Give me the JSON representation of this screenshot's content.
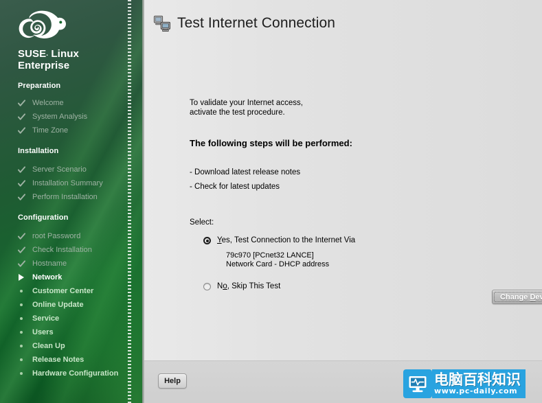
{
  "window": {
    "title": "Test Internet Connection",
    "title_icon": "network-computers-icon"
  },
  "sidebar": {
    "brand": {
      "line1_bold": "SUSE",
      "line1_reg": ".",
      "line1_rest": " Linux",
      "line2": "Enterprise",
      "logo_icon": "suse-chameleon-logo"
    },
    "sections": [
      {
        "heading": "Preparation",
        "items": [
          {
            "label": "Welcome",
            "state": "done",
            "mark": "check-icon"
          },
          {
            "label": "System Analysis",
            "state": "done",
            "mark": "check-icon"
          },
          {
            "label": "Time Zone",
            "state": "done",
            "mark": "check-icon"
          }
        ]
      },
      {
        "heading": "Installation",
        "items": [
          {
            "label": "Server Scenario",
            "state": "done",
            "mark": "check-icon"
          },
          {
            "label": "Installation Summary",
            "state": "done",
            "mark": "check-icon"
          },
          {
            "label": "Perform Installation",
            "state": "done",
            "mark": "check-icon"
          }
        ]
      },
      {
        "heading": "Configuration",
        "items": [
          {
            "label": "root Password",
            "state": "done",
            "mark": "check-icon"
          },
          {
            "label": "Check Installation",
            "state": "done",
            "mark": "check-icon"
          },
          {
            "label": "Hostname",
            "state": "done",
            "mark": "check-icon"
          },
          {
            "label": "Network",
            "state": "current",
            "mark": "triangle-right-icon"
          },
          {
            "label": "Customer Center",
            "state": "pending",
            "mark": "bullet-dot-icon"
          },
          {
            "label": "Online Update",
            "state": "pending",
            "mark": "bullet-dot-icon"
          },
          {
            "label": "Service",
            "state": "pending",
            "mark": "bullet-dot-icon"
          },
          {
            "label": "Users",
            "state": "pending",
            "mark": "bullet-dot-icon"
          },
          {
            "label": "Clean Up",
            "state": "pending",
            "mark": "bullet-dot-icon"
          },
          {
            "label": "Release Notes",
            "state": "pending",
            "mark": "bullet-dot-icon"
          },
          {
            "label": "Hardware Configuration",
            "state": "pending",
            "mark": "bullet-dot-icon"
          }
        ]
      }
    ]
  },
  "main": {
    "intro_line1": "To validate your Internet access,",
    "intro_line2": "activate the test procedure.",
    "steps_heading": "The following steps will be performed:",
    "steps": [
      "- Download latest release notes",
      "- Check for latest updates"
    ],
    "select_label": "Select:",
    "options": [
      {
        "accel": "Y",
        "text_before": "",
        "text_after": "es, Test Connection to the Internet Via",
        "selected": true
      },
      {
        "accel": "o",
        "text_before": "N",
        "text_after": ", Skip This Test",
        "selected": false
      }
    ],
    "device_line1": "79c970 [PCnet32 LANCE]",
    "device_line2": "Network Card - DHCP address",
    "change_device_accel": "D",
    "change_device_before": "Change ",
    "change_device_after": "evice"
  },
  "footer": {
    "help_label": "Help"
  },
  "watermark": {
    "chinese": "电脑百科知识",
    "url": "www.pc-daily.com",
    "icon": "monitor-waveform-icon",
    "color": "#29a3e0"
  },
  "colors": {
    "sidebar_green_dark": "#0a4a1d",
    "sidebar_green_top": "#3a5c4c",
    "panel_gray": "#e4e4e4",
    "footer_gray": "#d2d2d2",
    "text_black": "#000000",
    "done_text": "#9fb3a4",
    "pending_text": "#c8e6c8"
  }
}
